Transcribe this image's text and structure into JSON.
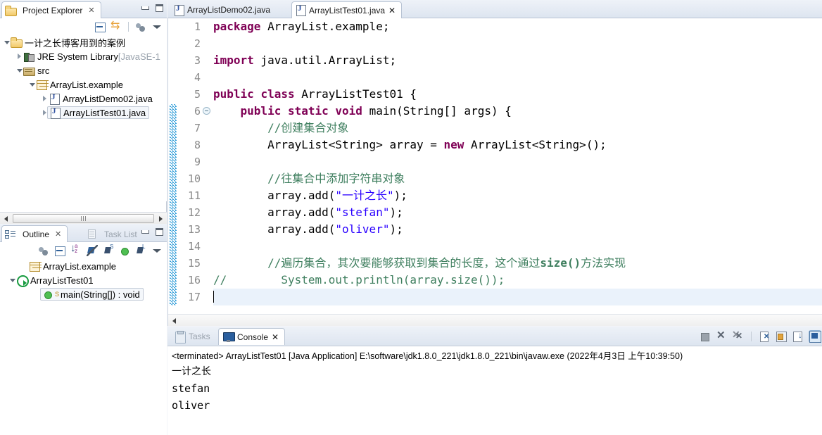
{
  "project_explorer": {
    "tab_label": "Project Explorer",
    "close_glyph": "✕",
    "toolbar_icons": [
      "collapse-all-icon",
      "link-with-editor-icon",
      "view-menu-icon",
      "view-menu-chevron-icon"
    ],
    "tree": [
      {
        "label": "一计之长博客用到的案例",
        "suffix": "",
        "icon": "project-folder-icon",
        "arrow": "down",
        "indent": 4,
        "selected": false
      },
      {
        "label": "JRE System Library",
        "suffix": " [JavaSE-1",
        "icon": "jre-library-icon",
        "arrow": "right",
        "indent": 22,
        "selected": false
      },
      {
        "label": "src",
        "suffix": "",
        "icon": "source-folder-icon",
        "arrow": "down",
        "indent": 22,
        "selected": false
      },
      {
        "label": "ArrayList.example",
        "suffix": "",
        "icon": "package-icon",
        "arrow": "down",
        "indent": 40,
        "selected": false
      },
      {
        "label": "ArrayListDemo02.java",
        "suffix": "",
        "icon": "java-file-icon",
        "arrow": "right",
        "indent": 58,
        "selected": false
      },
      {
        "label": "ArrayListTest01.java",
        "suffix": "",
        "icon": "java-file-icon",
        "arrow": "right",
        "indent": 58,
        "selected": true
      }
    ]
  },
  "outline": {
    "tab_label": "Outline",
    "inactive_tab_label": "Task List",
    "close_glyph": "✕",
    "toolbar_icons": [
      "view-menu-icon",
      "collapse-all-icon",
      "sort-icon",
      "hide-fields-icon",
      "hide-static-icon",
      "hide-nonpublic-icon",
      "hide-local-icon",
      "view-menu-chevron-icon"
    ],
    "tree": [
      {
        "label": "ArrayList.example",
        "icon": "package-icon",
        "arrow": "none",
        "indent": 30,
        "selected": false,
        "static_marker": ""
      },
      {
        "label": "ArrayListTest01",
        "icon": "class-icon",
        "arrow": "down",
        "indent": 12,
        "selected": false,
        "static_marker": ""
      },
      {
        "label": "main(String[]) : void",
        "icon": "method-icon",
        "arrow": "none",
        "indent": 48,
        "selected": true,
        "static_marker": "S"
      }
    ]
  },
  "editor": {
    "tabs": [
      {
        "label": "ArrayListDemo02.java",
        "active": false,
        "closeable": false
      },
      {
        "label": "ArrayListTest01.java",
        "active": true,
        "closeable": true
      }
    ],
    "close_glyph": "✕",
    "first_line": 1,
    "total_lines": 17,
    "change_bar_from_line": 6,
    "fold_marker_line": 6,
    "caret_line": 17,
    "line_numbers": [
      "1",
      "2",
      "3",
      "4",
      "5",
      "6",
      "7",
      "8",
      "9",
      "10",
      "11",
      "12",
      "13",
      "14",
      "15",
      "16",
      "17"
    ],
    "lines": [
      {
        "n": 1,
        "tokens": [
          {
            "t": "package",
            "c": "kw"
          },
          {
            "t": " ArrayList.example;",
            "c": ""
          }
        ]
      },
      {
        "n": 2,
        "tokens": [
          {
            "t": "",
            "c": ""
          }
        ]
      },
      {
        "n": 3,
        "tokens": [
          {
            "t": "import",
            "c": "kw"
          },
          {
            "t": " java.util.ArrayList;",
            "c": ""
          }
        ]
      },
      {
        "n": 4,
        "tokens": [
          {
            "t": "",
            "c": ""
          }
        ]
      },
      {
        "n": 5,
        "tokens": [
          {
            "t": "public",
            "c": "kw"
          },
          {
            "t": " ",
            "c": ""
          },
          {
            "t": "class",
            "c": "kw"
          },
          {
            "t": " ArrayListTest01 {",
            "c": ""
          }
        ]
      },
      {
        "n": 6,
        "tokens": [
          {
            "t": "    ",
            "c": ""
          },
          {
            "t": "public",
            "c": "kw"
          },
          {
            "t": " ",
            "c": ""
          },
          {
            "t": "static",
            "c": "kw"
          },
          {
            "t": " ",
            "c": ""
          },
          {
            "t": "void",
            "c": "kw"
          },
          {
            "t": " main(String[] args) {",
            "c": ""
          }
        ]
      },
      {
        "n": 7,
        "tokens": [
          {
            "t": "        ",
            "c": ""
          },
          {
            "t": "//创建集合对象",
            "c": "cmt"
          }
        ]
      },
      {
        "n": 8,
        "tokens": [
          {
            "t": "        ArrayList<String> array = ",
            "c": ""
          },
          {
            "t": "new",
            "c": "kw"
          },
          {
            "t": " ArrayList<String>();",
            "c": ""
          }
        ]
      },
      {
        "n": 9,
        "tokens": [
          {
            "t": "",
            "c": ""
          }
        ]
      },
      {
        "n": 10,
        "tokens": [
          {
            "t": "        ",
            "c": ""
          },
          {
            "t": "//往集合中添加字符串对象",
            "c": "cmt"
          }
        ]
      },
      {
        "n": 11,
        "tokens": [
          {
            "t": "        array.add(",
            "c": ""
          },
          {
            "t": "\"一计之长\"",
            "c": "str"
          },
          {
            "t": ");",
            "c": ""
          }
        ]
      },
      {
        "n": 12,
        "tokens": [
          {
            "t": "        array.add(",
            "c": ""
          },
          {
            "t": "\"stefan\"",
            "c": "str"
          },
          {
            "t": ");",
            "c": ""
          }
        ]
      },
      {
        "n": 13,
        "tokens": [
          {
            "t": "        array.add(",
            "c": ""
          },
          {
            "t": "\"oliver\"",
            "c": "str"
          },
          {
            "t": ");",
            "c": ""
          }
        ]
      },
      {
        "n": 14,
        "tokens": [
          {
            "t": "",
            "c": ""
          }
        ]
      },
      {
        "n": 15,
        "tokens": [
          {
            "t": "        ",
            "c": ""
          },
          {
            "t": "//遍历集合，其次要能够获取到集合的长度，这个通过",
            "c": "cmt"
          },
          {
            "t": "size()",
            "c": "cmt-b"
          },
          {
            "t": "方法实现",
            "c": "cmt"
          }
        ]
      },
      {
        "n": 16,
        "tokens": [
          {
            "t": "//",
            "c": "cmt"
          },
          {
            "t": "        ",
            "c": ""
          },
          {
            "t": "System.out.println(array.size());",
            "c": "cmt"
          }
        ]
      },
      {
        "n": 17,
        "tokens": [
          {
            "t": "",
            "c": ""
          }
        ]
      }
    ]
  },
  "console": {
    "tabs": [
      {
        "label": "Tasks",
        "active": false,
        "closeable": false,
        "icon": "tasks-icon"
      },
      {
        "label": "Console",
        "active": true,
        "closeable": true,
        "icon": "console-icon"
      }
    ],
    "close_glyph": "✕",
    "toolbar_icons": [
      "terminate-icon",
      "remove-launch-icon",
      "remove-all-terminated-icon",
      "clear-console-icon",
      "scroll-lock-icon",
      "pin-console-icon",
      "display-selected-console-icon"
    ],
    "terminated_line": "<terminated> ArrayListTest01 [Java Application] E:\\software\\jdk1.8.0_221\\jdk1.8.0_221\\bin\\javaw.exe (2022年4月3日 上午10:39:50)",
    "output_lines": [
      "一计之长",
      "stefan",
      "oliver"
    ]
  },
  "colors": {
    "keyword": "#7f0055",
    "string": "#2a00ff",
    "comment": "#3f7f5f",
    "gutter_text": "#8a8a8a",
    "change_bar": "#2196d6",
    "caret_line_bg": "#eaf2fb",
    "panel_bg": "#f2f5fa",
    "tab_border": "#b9c4d4"
  }
}
